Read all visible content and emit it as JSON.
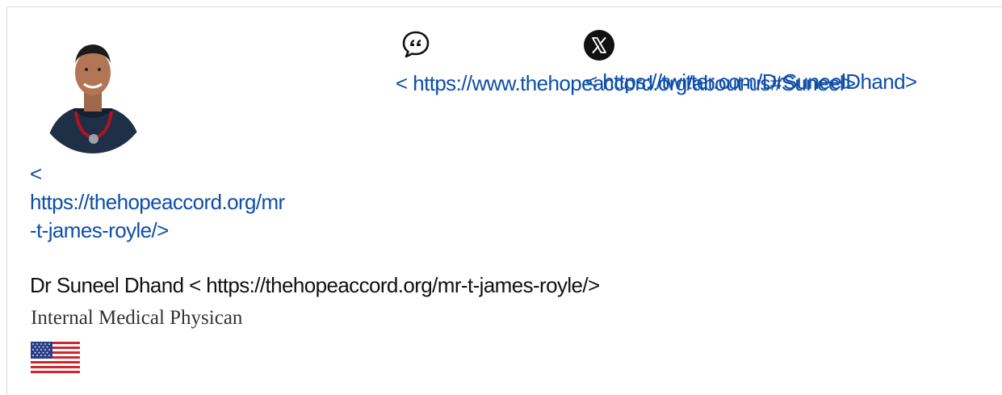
{
  "profile": {
    "link_lines": [
      "<",
      "https://thehopeaccord.org/mr",
      "-t-james-royle/>"
    ],
    "name": "Dr Suneel Dhand",
    "name_link": "< https://thehopeaccord.org/mr-t-james-royle/>",
    "role": "Internal Medical Physican"
  },
  "social": {
    "quote_icon": "speech-bubble-quote-icon",
    "quote_link": "< https://www.thehopeaccord.org/about-us#Suneel>",
    "x_icon": "x-logo-icon",
    "twitter_link": "< https://twitter.com/DrSuneelDhand>"
  },
  "flag": "usa-flag-icon",
  "colors": {
    "link": "#0d4ea8",
    "text": "#111111",
    "role_text": "#333333",
    "flag_red": "#d0262e",
    "flag_blue": "#2b3f86"
  }
}
